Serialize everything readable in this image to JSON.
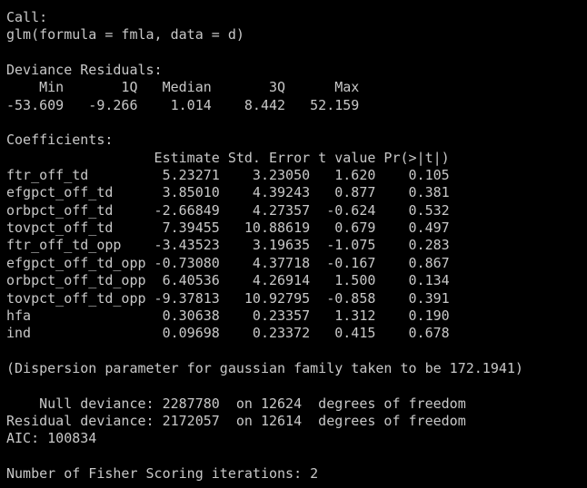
{
  "console": {
    "colors": {
      "background": "#000000",
      "text": "#c8c8c8"
    },
    "lines": [
      "Call:",
      "glm(formula = fmla, data = d)",
      "",
      "Deviance Residuals:",
      "    Min       1Q   Median       3Q      Max  ",
      "-53.609   -9.266    1.014    8.442   52.159  ",
      "",
      "Coefficients:",
      "                  Estimate Std. Error t value Pr(>|t|)",
      "ftr_off_td         5.23271    3.23050   1.620    0.105",
      "efgpct_off_td      3.85010    4.39243   0.877    0.381",
      "orbpct_off_td     -2.66849    4.27357  -0.624    0.532",
      "tovpct_off_td      7.39455   10.88619   0.679    0.497",
      "ftr_off_td_opp    -3.43523    3.19635  -1.075    0.283",
      "efgpct_off_td_opp -0.73080    4.37718  -0.167    0.867",
      "orbpct_off_td_opp  6.40536    4.26914   1.500    0.134",
      "tovpct_off_td_opp -9.37813   10.92795  -0.858    0.391",
      "hfa                0.30638    0.23357   1.312    0.190",
      "ind                0.09698    0.23372   0.415    0.678",
      "",
      "(Dispersion parameter for gaussian family taken to be 172.1941)",
      "",
      "    Null deviance: 2287780  on 12624  degrees of freedom",
      "Residual deviance: 2172057  on 12614  degrees of freedom",
      "AIC: 100834",
      "",
      "Number of Fisher Scoring iterations: 2"
    ]
  }
}
